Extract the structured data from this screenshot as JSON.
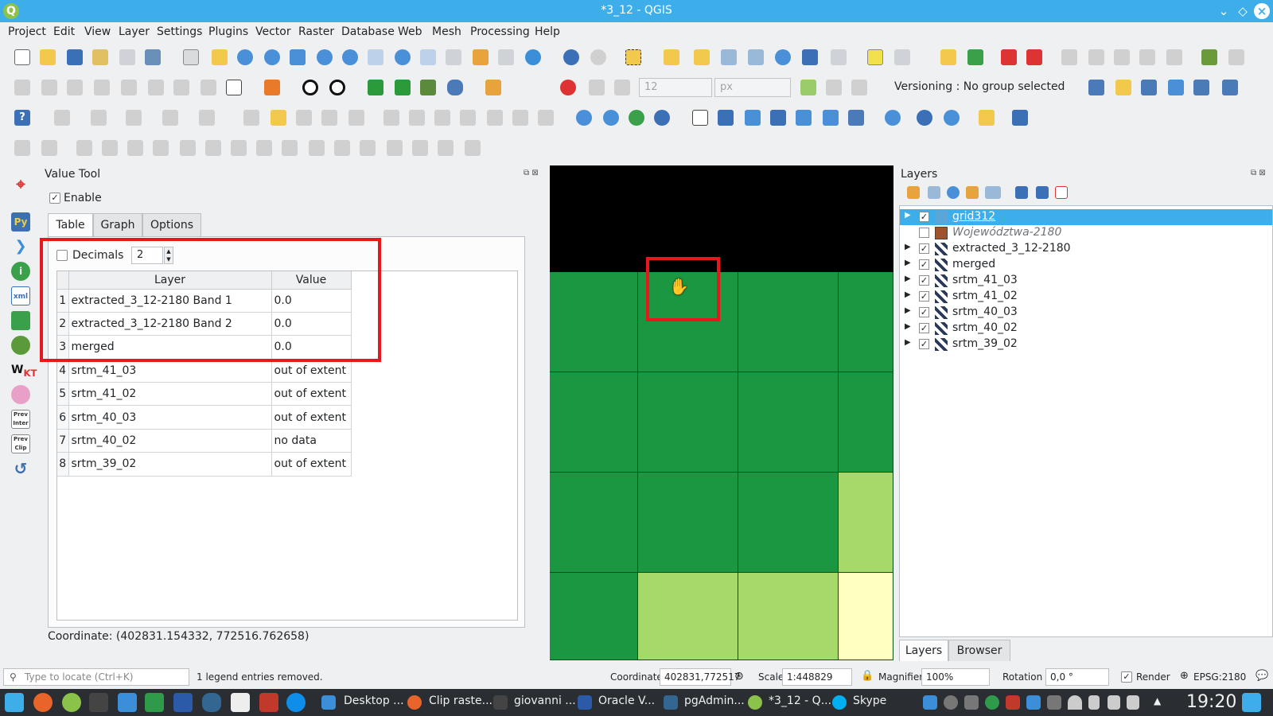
{
  "window": {
    "title": "*3_12 - QGIS"
  },
  "menu": [
    "Project",
    "Edit",
    "View",
    "Layer",
    "Settings",
    "Plugins",
    "Vector",
    "Raster",
    "Database",
    "Web",
    "Mesh",
    "Processing",
    "Help"
  ],
  "toolbar": {
    "versioning": "Versioning : No group selected",
    "font_size": "12",
    "font_unit": "px"
  },
  "value_tool": {
    "title": "Value Tool",
    "enable_label": "Enable",
    "enable_checked": true,
    "tabs": [
      "Table",
      "Graph",
      "Options"
    ],
    "active_tab": "Table",
    "decimals_label": "Decimals",
    "decimals_value": "2",
    "columns": [
      "Layer",
      "Value"
    ],
    "rows": [
      {
        "n": "1",
        "layer": "extracted_3_12-2180 Band 1",
        "value": "0.0"
      },
      {
        "n": "2",
        "layer": "extracted_3_12-2180 Band 2",
        "value": "0.0"
      },
      {
        "n": "3",
        "layer": "merged",
        "value": "0.0"
      },
      {
        "n": "4",
        "layer": "srtm_41_03",
        "value": "out of extent"
      },
      {
        "n": "5",
        "layer": "srtm_41_02",
        "value": "out of extent"
      },
      {
        "n": "6",
        "layer": "srtm_40_03",
        "value": "out of extent"
      },
      {
        "n": "7",
        "layer": "srtm_40_02",
        "value": "no data"
      },
      {
        "n": "8",
        "layer": "srtm_39_02",
        "value": "out of extent"
      }
    ],
    "coordinate": "Coordinate: (402831.154332, 772516.762658)"
  },
  "layers_panel": {
    "title": "Layers",
    "layers": [
      {
        "name": "grid312",
        "checked": true,
        "selected": true,
        "italic": false,
        "symbol": "group"
      },
      {
        "name": "Województwa-2180",
        "checked": false,
        "selected": false,
        "italic": true,
        "symbol": "polygon"
      },
      {
        "name": "extracted_3_12-2180",
        "checked": true,
        "selected": false,
        "italic": false,
        "symbol": "raster"
      },
      {
        "name": "merged",
        "checked": true,
        "selected": false,
        "italic": false,
        "symbol": "raster"
      },
      {
        "name": "srtm_41_03",
        "checked": true,
        "selected": false,
        "italic": false,
        "symbol": "raster"
      },
      {
        "name": "srtm_41_02",
        "checked": true,
        "selected": false,
        "italic": false,
        "symbol": "raster"
      },
      {
        "name": "srtm_40_03",
        "checked": true,
        "selected": false,
        "italic": false,
        "symbol": "raster"
      },
      {
        "name": "srtm_40_02",
        "checked": true,
        "selected": false,
        "italic": false,
        "symbol": "raster"
      },
      {
        "name": "srtm_39_02",
        "checked": true,
        "selected": false,
        "italic": false,
        "symbol": "raster"
      }
    ],
    "bottom_tabs": [
      "Layers",
      "Browser"
    ]
  },
  "statusbar": {
    "locate_placeholder": "Type to locate (Ctrl+K)",
    "message": "1 legend entries removed.",
    "coordinate_label": "Coordinate",
    "coordinate_value": "402831,772517",
    "scale_label": "Scale",
    "scale_value": "1:448829",
    "magnifier_label": "Magnifier",
    "magnifier_value": "100%",
    "rotation_label": "Rotation",
    "rotation_value": "0,0 °",
    "render_label": "Render",
    "crs": "EPSG:2180"
  },
  "taskbar": {
    "items": [
      "Desktop ...",
      "Clip raste...",
      "giovanni ...",
      "Oracle V...",
      "pgAdmin...",
      "*3_12 - Q...",
      "Skype"
    ],
    "clock": "19:20"
  },
  "map": {
    "colors": {
      "background": "#000000",
      "dark_green": "#1b9641",
      "light_green": "#a6d96a",
      "pale_yellow": "#ffffbf"
    }
  }
}
